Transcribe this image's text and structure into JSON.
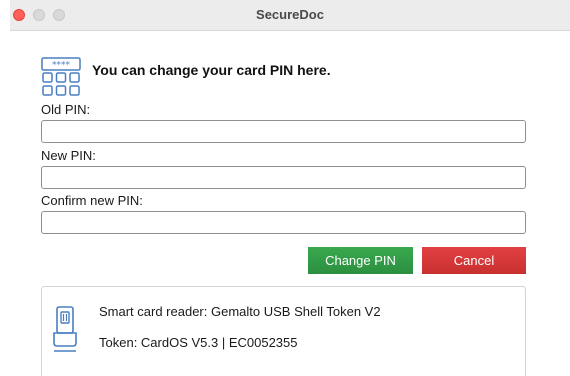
{
  "window": {
    "title": "SecureDoc"
  },
  "header": {
    "message": "You can change your card PIN here.",
    "icon": "keypad-icon"
  },
  "form": {
    "old_pin": {
      "label": "Old PIN:",
      "value": "",
      "placeholder": ""
    },
    "new_pin": {
      "label": "New PIN:",
      "value": "",
      "placeholder": ""
    },
    "confirm_pin": {
      "label": "Confirm new PIN:",
      "value": "",
      "placeholder": ""
    }
  },
  "buttons": {
    "change_pin": "Change PIN",
    "cancel": "Cancel"
  },
  "info": {
    "icon": "smart-card-reader-icon",
    "reader": "Smart card reader: Gemalto USB Shell Token V2",
    "token": "Token: CardOS V5.3 | EC0052355"
  },
  "colors": {
    "change_button": "#2ea043",
    "cancel_button": "#d9383a",
    "close_light": "#ff5f57",
    "icon_blue": "#4a7fc1"
  }
}
